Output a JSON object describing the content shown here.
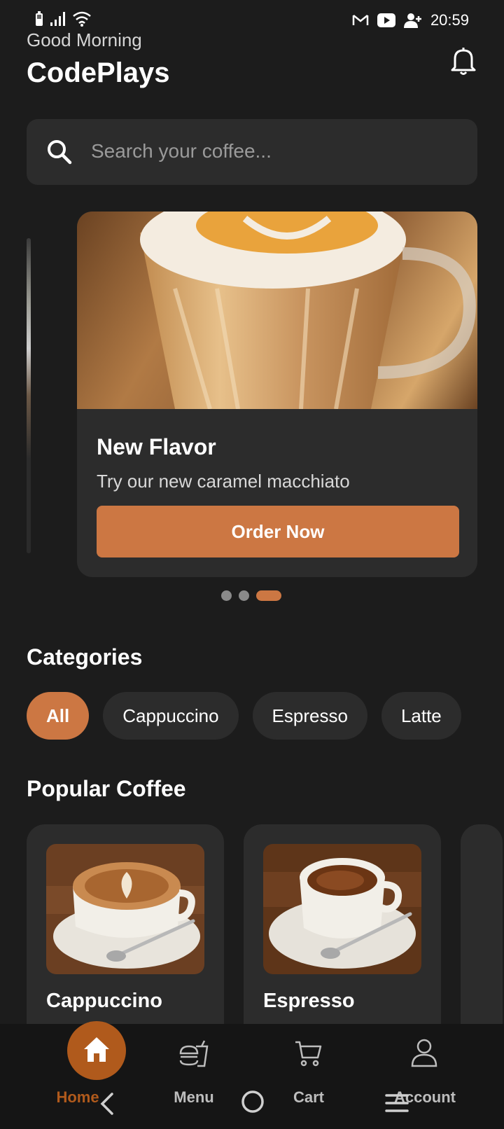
{
  "status_bar": {
    "time": "20:59",
    "left_icons": [
      "battery-icon",
      "signal-icon",
      "wifi-icon"
    ],
    "right_icons": [
      "gmail-icon",
      "youtube-icon",
      "person-add-icon"
    ]
  },
  "header": {
    "greeting": "Good Morning",
    "brand": "CodePlays",
    "notification_icon": "bell-icon"
  },
  "search": {
    "placeholder": "Search your coffee...",
    "icon": "search-icon"
  },
  "banner": {
    "title": "New Flavor",
    "subtitle": "Try our new caramel macchiato",
    "button_label": "Order Now",
    "page_count": 3,
    "active_page": 3
  },
  "categories": {
    "title": "Categories",
    "items": [
      {
        "label": "All",
        "active": true
      },
      {
        "label": "Cappuccino",
        "active": false
      },
      {
        "label": "Espresso",
        "active": false
      },
      {
        "label": "Latte",
        "active": false
      }
    ]
  },
  "popular": {
    "title": "Popular Coffee",
    "items": [
      {
        "name": "Cappuccino"
      },
      {
        "name": "Espresso"
      }
    ]
  },
  "bottom_nav": {
    "items": [
      {
        "label": "Home",
        "icon": "home-icon",
        "active": true
      },
      {
        "label": "Menu",
        "icon": "food-icon",
        "active": false
      },
      {
        "label": "Cart",
        "icon": "cart-icon",
        "active": false
      },
      {
        "label": "Account",
        "icon": "person-icon",
        "active": false
      }
    ]
  },
  "colors": {
    "accent": "#cc7743",
    "background": "#1c1c1c",
    "surface": "#2c2c2c",
    "nav_active": "#b05a1c"
  }
}
